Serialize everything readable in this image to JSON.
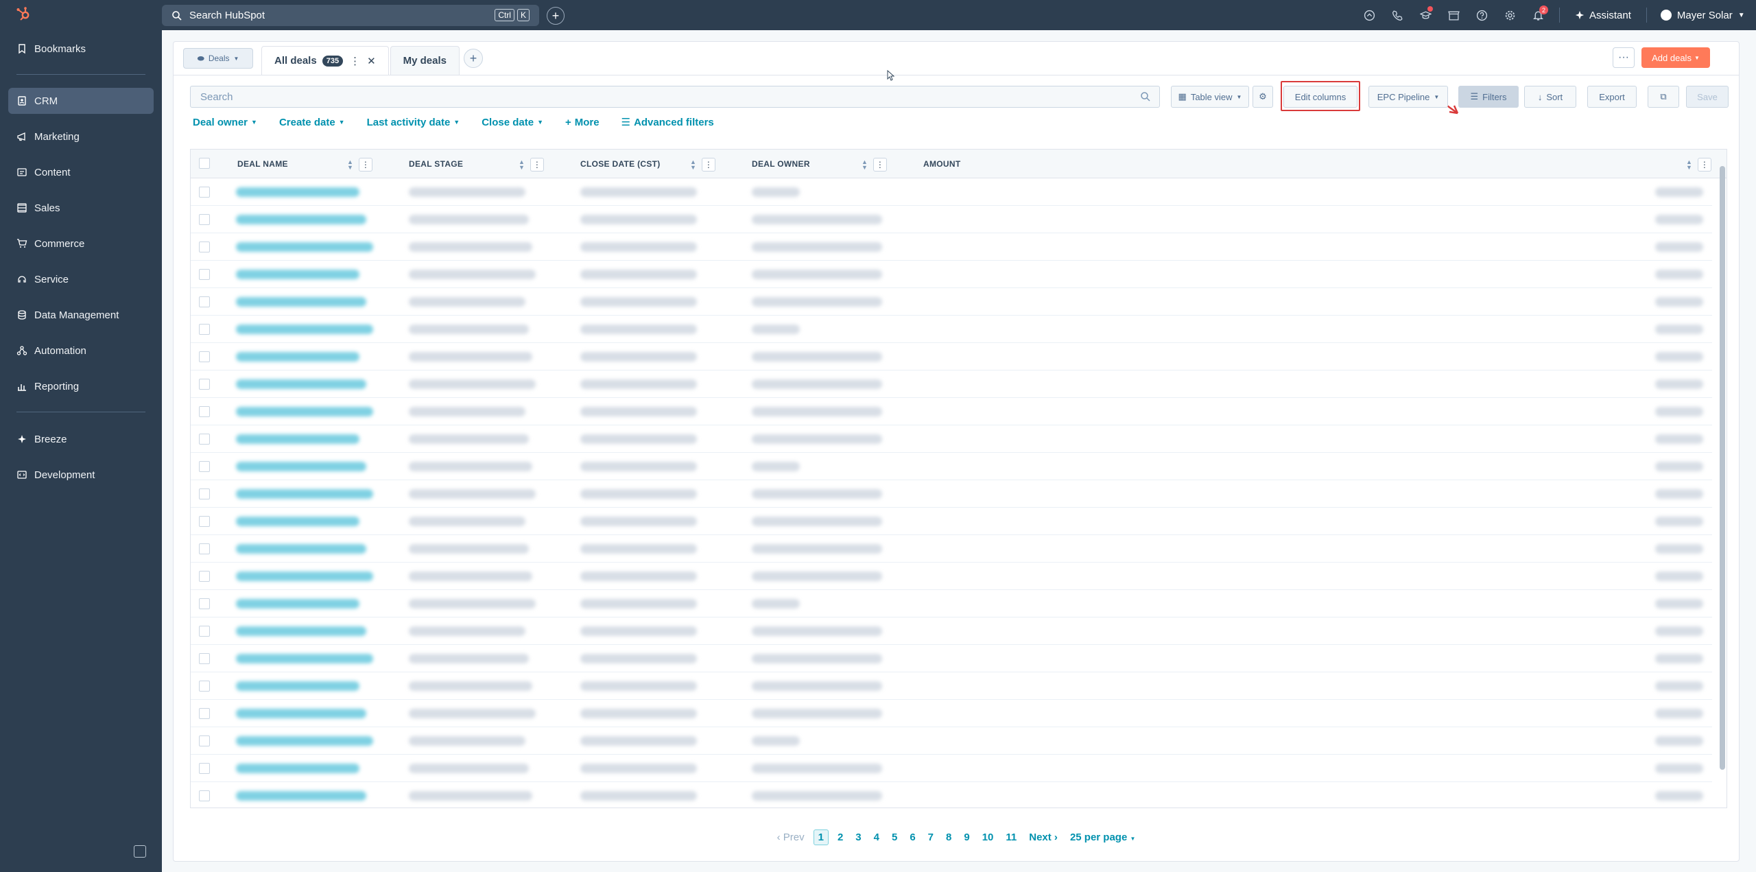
{
  "app": {
    "search_placeholder": "Search HubSpot",
    "shortcut_keys": [
      "Ctrl",
      "K"
    ],
    "assistant": "Assistant",
    "account": "Mayer Solar",
    "notifications_count": "2"
  },
  "sidebar": {
    "items": [
      {
        "label": "Bookmarks",
        "icon": "bookmark-icon"
      },
      {
        "label": "CRM",
        "icon": "crm-icon",
        "active": true
      },
      {
        "label": "Marketing",
        "icon": "megaphone-icon"
      },
      {
        "label": "Content",
        "icon": "content-icon"
      },
      {
        "label": "Sales",
        "icon": "sales-icon"
      },
      {
        "label": "Commerce",
        "icon": "cart-icon"
      },
      {
        "label": "Service",
        "icon": "service-icon"
      },
      {
        "label": "Data Management",
        "icon": "database-icon"
      },
      {
        "label": "Automation",
        "icon": "automation-icon"
      },
      {
        "label": "Reporting",
        "icon": "chart-icon"
      },
      {
        "label": "Breeze",
        "icon": "sparkle-icon"
      },
      {
        "label": "Development",
        "icon": "code-icon"
      }
    ]
  },
  "header": {
    "object_selector": "Deals",
    "tabs": [
      {
        "label": "All deals",
        "count": "735",
        "active": true
      },
      {
        "label": "My deals"
      }
    ],
    "more": "···",
    "add_button": "Add deals"
  },
  "toolbar": {
    "search_placeholder": "Search",
    "table_view": "Table view",
    "edit_columns": "Edit columns",
    "pipeline": "EPC Pipeline",
    "filters": "Filters",
    "sort": "Sort",
    "export": "Export",
    "save": "Save"
  },
  "quick_filters": [
    "Deal owner",
    "Create date",
    "Last activity date",
    "Close date"
  ],
  "more_filters": "More",
  "advanced_filters": "Advanced filters",
  "table": {
    "columns": [
      "DEAL NAME",
      "DEAL STAGE",
      "CLOSE DATE (CST)",
      "DEAL OWNER",
      "AMOUNT"
    ],
    "row_count": 23
  },
  "pagination": {
    "prev": "Prev",
    "pages": [
      "1",
      "2",
      "3",
      "4",
      "5",
      "6",
      "7",
      "8",
      "9",
      "10",
      "11"
    ],
    "current": "1",
    "next": "Next",
    "per_page": "25 per page"
  },
  "colors": {
    "sidebar_bg": "#2d3e50",
    "accent": "#0091ae",
    "primary_button": "#ff7a59",
    "highlight_box": "#d93a3a"
  }
}
